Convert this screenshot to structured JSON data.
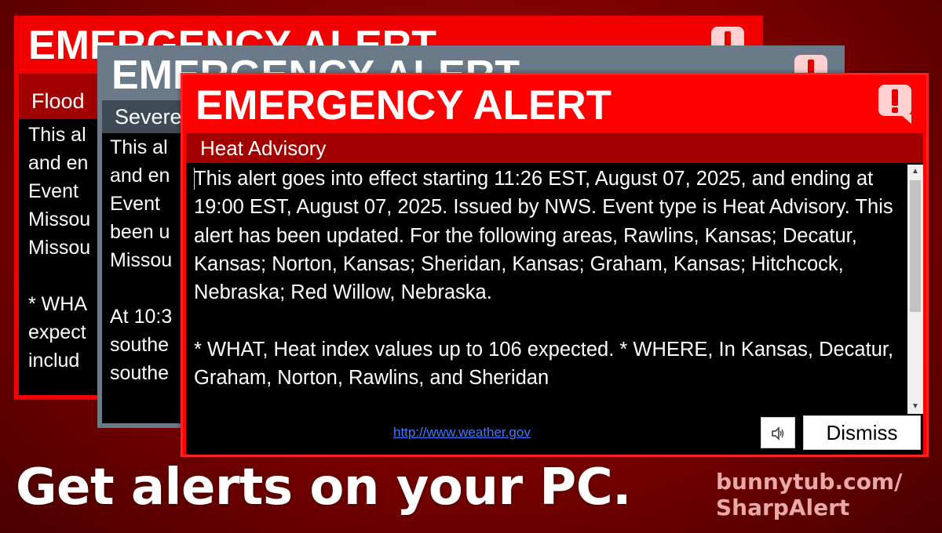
{
  "windows": [
    {
      "title": "EMERGENCY ALERT",
      "event": "Flood",
      "body": "This al\nand en\nEvent \nMissou\nMissou\n\n* WHA\nexpect\ninclud",
      "icon": "alert-exclamation-icon",
      "color": "#f20000"
    },
    {
      "title": "EMERGENCY ALERT",
      "event": "Severe",
      "body": "This al\nand en\nEvent \nbeen u\nMissou\n\nAt 10:3\nsouthe\nsouthe",
      "icon": "alert-exclamation-icon",
      "color": "#6a7a88"
    },
    {
      "title": "EMERGENCY ALERT",
      "event": "Heat Advisory",
      "body": "This alert goes into effect starting 11:26 EST, August 07, 2025, and ending at 19:00 EST, August 07, 2025. Issued by NWS. Event type is Heat Advisory. This alert has been updated. For the following areas, Rawlins, Kansas; Decatur, Kansas; Norton, Kansas; Sheridan, Kansas; Graham, Kansas; Hitchcock, Nebraska; Red Willow, Nebraska.\n\n* WHAT, Heat index values up to 106 expected. * WHERE, In Kansas, Decatur, Graham, Norton, Rawlins, and Sheridan",
      "link": "http://www.weather.gov",
      "dismiss_label": "Dismiss",
      "icon": "alert-exclamation-icon",
      "color": "#ff0000"
    }
  ],
  "tagline": "Get alerts on your PC.",
  "promo_url_line1": "bunnytub.com/",
  "promo_url_line2": "SharpAlert"
}
